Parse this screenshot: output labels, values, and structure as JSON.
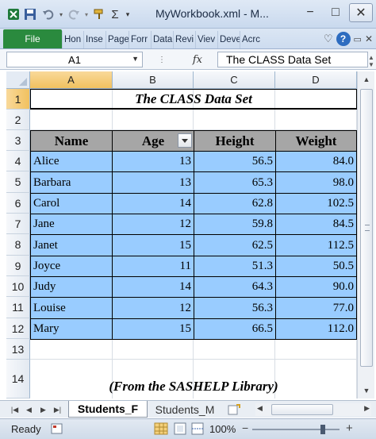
{
  "window": {
    "title": "MyWorkbook.xml - M...",
    "minimize_glyph": "−",
    "maximize_glyph": "□",
    "close_glyph": "✕"
  },
  "ribbon": {
    "file_label": "File",
    "tabs": [
      "Hon",
      "Inse",
      "Page",
      "Forr",
      "Data",
      "Revi",
      "Viev",
      "Deve",
      "Acrc"
    ],
    "help_glyph": "?"
  },
  "formula_bar": {
    "name_box": "A1",
    "fx_label": "fx",
    "formula_value": "The CLASS Data Set"
  },
  "grid": {
    "columns": [
      "A",
      "B",
      "C",
      "D"
    ],
    "row_numbers": [
      "1",
      "2",
      "3",
      "4",
      "5",
      "6",
      "7",
      "8",
      "9",
      "10",
      "11",
      "12",
      "13",
      "14"
    ],
    "title": "The CLASS Data Set",
    "headers": [
      "Name",
      "Age",
      "Height",
      "Weight"
    ],
    "rows": [
      [
        "Alice",
        "13",
        "56.5",
        "84.0"
      ],
      [
        "Barbara",
        "13",
        "65.3",
        "98.0"
      ],
      [
        "Carol",
        "14",
        "62.8",
        "102.5"
      ],
      [
        "Jane",
        "12",
        "59.8",
        "84.5"
      ],
      [
        "Janet",
        "15",
        "62.5",
        "112.5"
      ],
      [
        "Joyce",
        "11",
        "51.3",
        "50.5"
      ],
      [
        "Judy",
        "14",
        "64.3",
        "90.0"
      ],
      [
        "Louise",
        "12",
        "56.3",
        "77.0"
      ],
      [
        "Mary",
        "15",
        "66.5",
        "112.0"
      ]
    ],
    "footer": "(From the SASHELP Library)"
  },
  "sheets": {
    "tabs": [
      "Students_F",
      "Students_M"
    ],
    "active": "Students_F"
  },
  "status": {
    "ready": "Ready",
    "zoom": "100%"
  },
  "colors": {
    "header_fill": "#a6a6a6",
    "data_fill": "#99ccff",
    "file_tab": "#2a8a3e",
    "selection_header": "#f1c15f"
  }
}
